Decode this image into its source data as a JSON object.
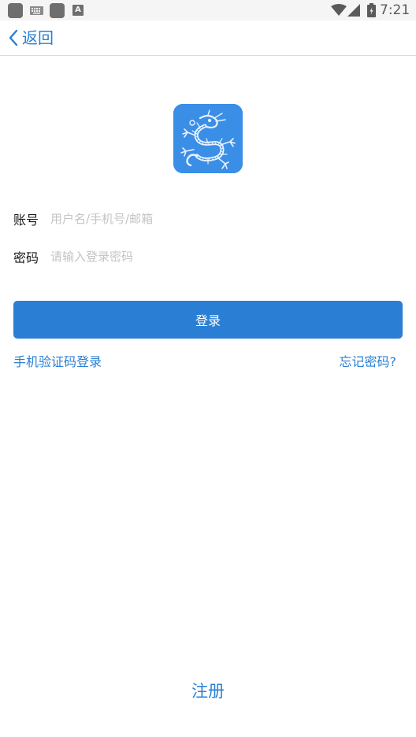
{
  "status_bar": {
    "time": "7:21",
    "icons": [
      "app-square-icon",
      "keyboard-icon",
      "app-square-icon",
      "font-a-icon",
      "wifi-icon",
      "cell-signal-icon",
      "battery-icon"
    ],
    "font_icon_letter": "A"
  },
  "nav": {
    "back_label": "返回",
    "back_icon": "chevron-left-icon"
  },
  "logo": {
    "icon": "dragon-logo-icon",
    "bg_color": "#3a8ee6"
  },
  "form": {
    "account_label": "账号",
    "account_placeholder": "用户名/手机号/邮箱",
    "account_value": "",
    "password_label": "密码",
    "password_placeholder": "请输入登录密码",
    "password_value": ""
  },
  "login_button_label": "登录",
  "links": {
    "sms_login": "手机验证码登录",
    "forgot_password": "忘记密码?"
  },
  "register_label": "注册",
  "colors": {
    "accent": "#2a7fd4",
    "placeholder": "#c4c4c4"
  }
}
